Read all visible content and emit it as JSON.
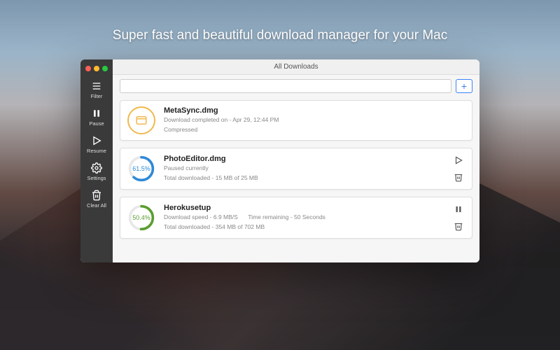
{
  "hero": "Super fast and beautiful download manager for your Mac",
  "header": {
    "title": "All Downloads"
  },
  "sidebar": {
    "items": [
      {
        "label": "Filter"
      },
      {
        "label": "Pause"
      },
      {
        "label": "Resume"
      },
      {
        "label": "Settings"
      },
      {
        "label": "Clear All"
      }
    ]
  },
  "toolbar": {
    "url_placeholder": "",
    "add_label": "+"
  },
  "downloads": [
    {
      "name": "MetaSync.dmg",
      "status_line": "Download completed on - Apr 29, 12:44 PM",
      "subline": "Compressed",
      "state": "complete",
      "icon_color": "#f0b94d"
    },
    {
      "name": "PhotoEditor.dmg",
      "status_line": "Paused currently",
      "subline": "Total downloaded - 15 MB of 25 MB",
      "state": "paused",
      "percent": 61.5,
      "percent_label": "61.5%",
      "ring_color": "#2f8ad8"
    },
    {
      "name": "Herokusetup",
      "status_line": "Download speed - 6.9 MB/S",
      "time_remaining": "Time remaining - 50 Seconds",
      "subline": "Total downloaded - 354 MB of 702 MB",
      "state": "active",
      "percent": 50.4,
      "percent_label": "50.4%",
      "ring_color": "#5a9e2f"
    }
  ]
}
